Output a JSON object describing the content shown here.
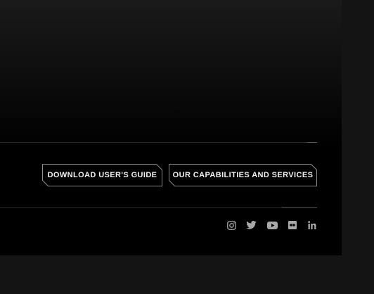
{
  "footer": {
    "buttons": {
      "guide_label": "DOWNLOAD USER'S GUIDE",
      "capabilities_label": "OUR CAPABILITIES AND SERVICES"
    },
    "social_icons": [
      "instagram-icon",
      "twitter-icon",
      "youtube-icon",
      "flickr-icon",
      "linkedin-icon"
    ]
  },
  "colors": {
    "background": "#141414",
    "panel": "#000000",
    "button_border": "#8a8a8a",
    "button_text": "#f2f2f2",
    "icon": "#a8a8a8",
    "rule": "#2c2c2c"
  }
}
